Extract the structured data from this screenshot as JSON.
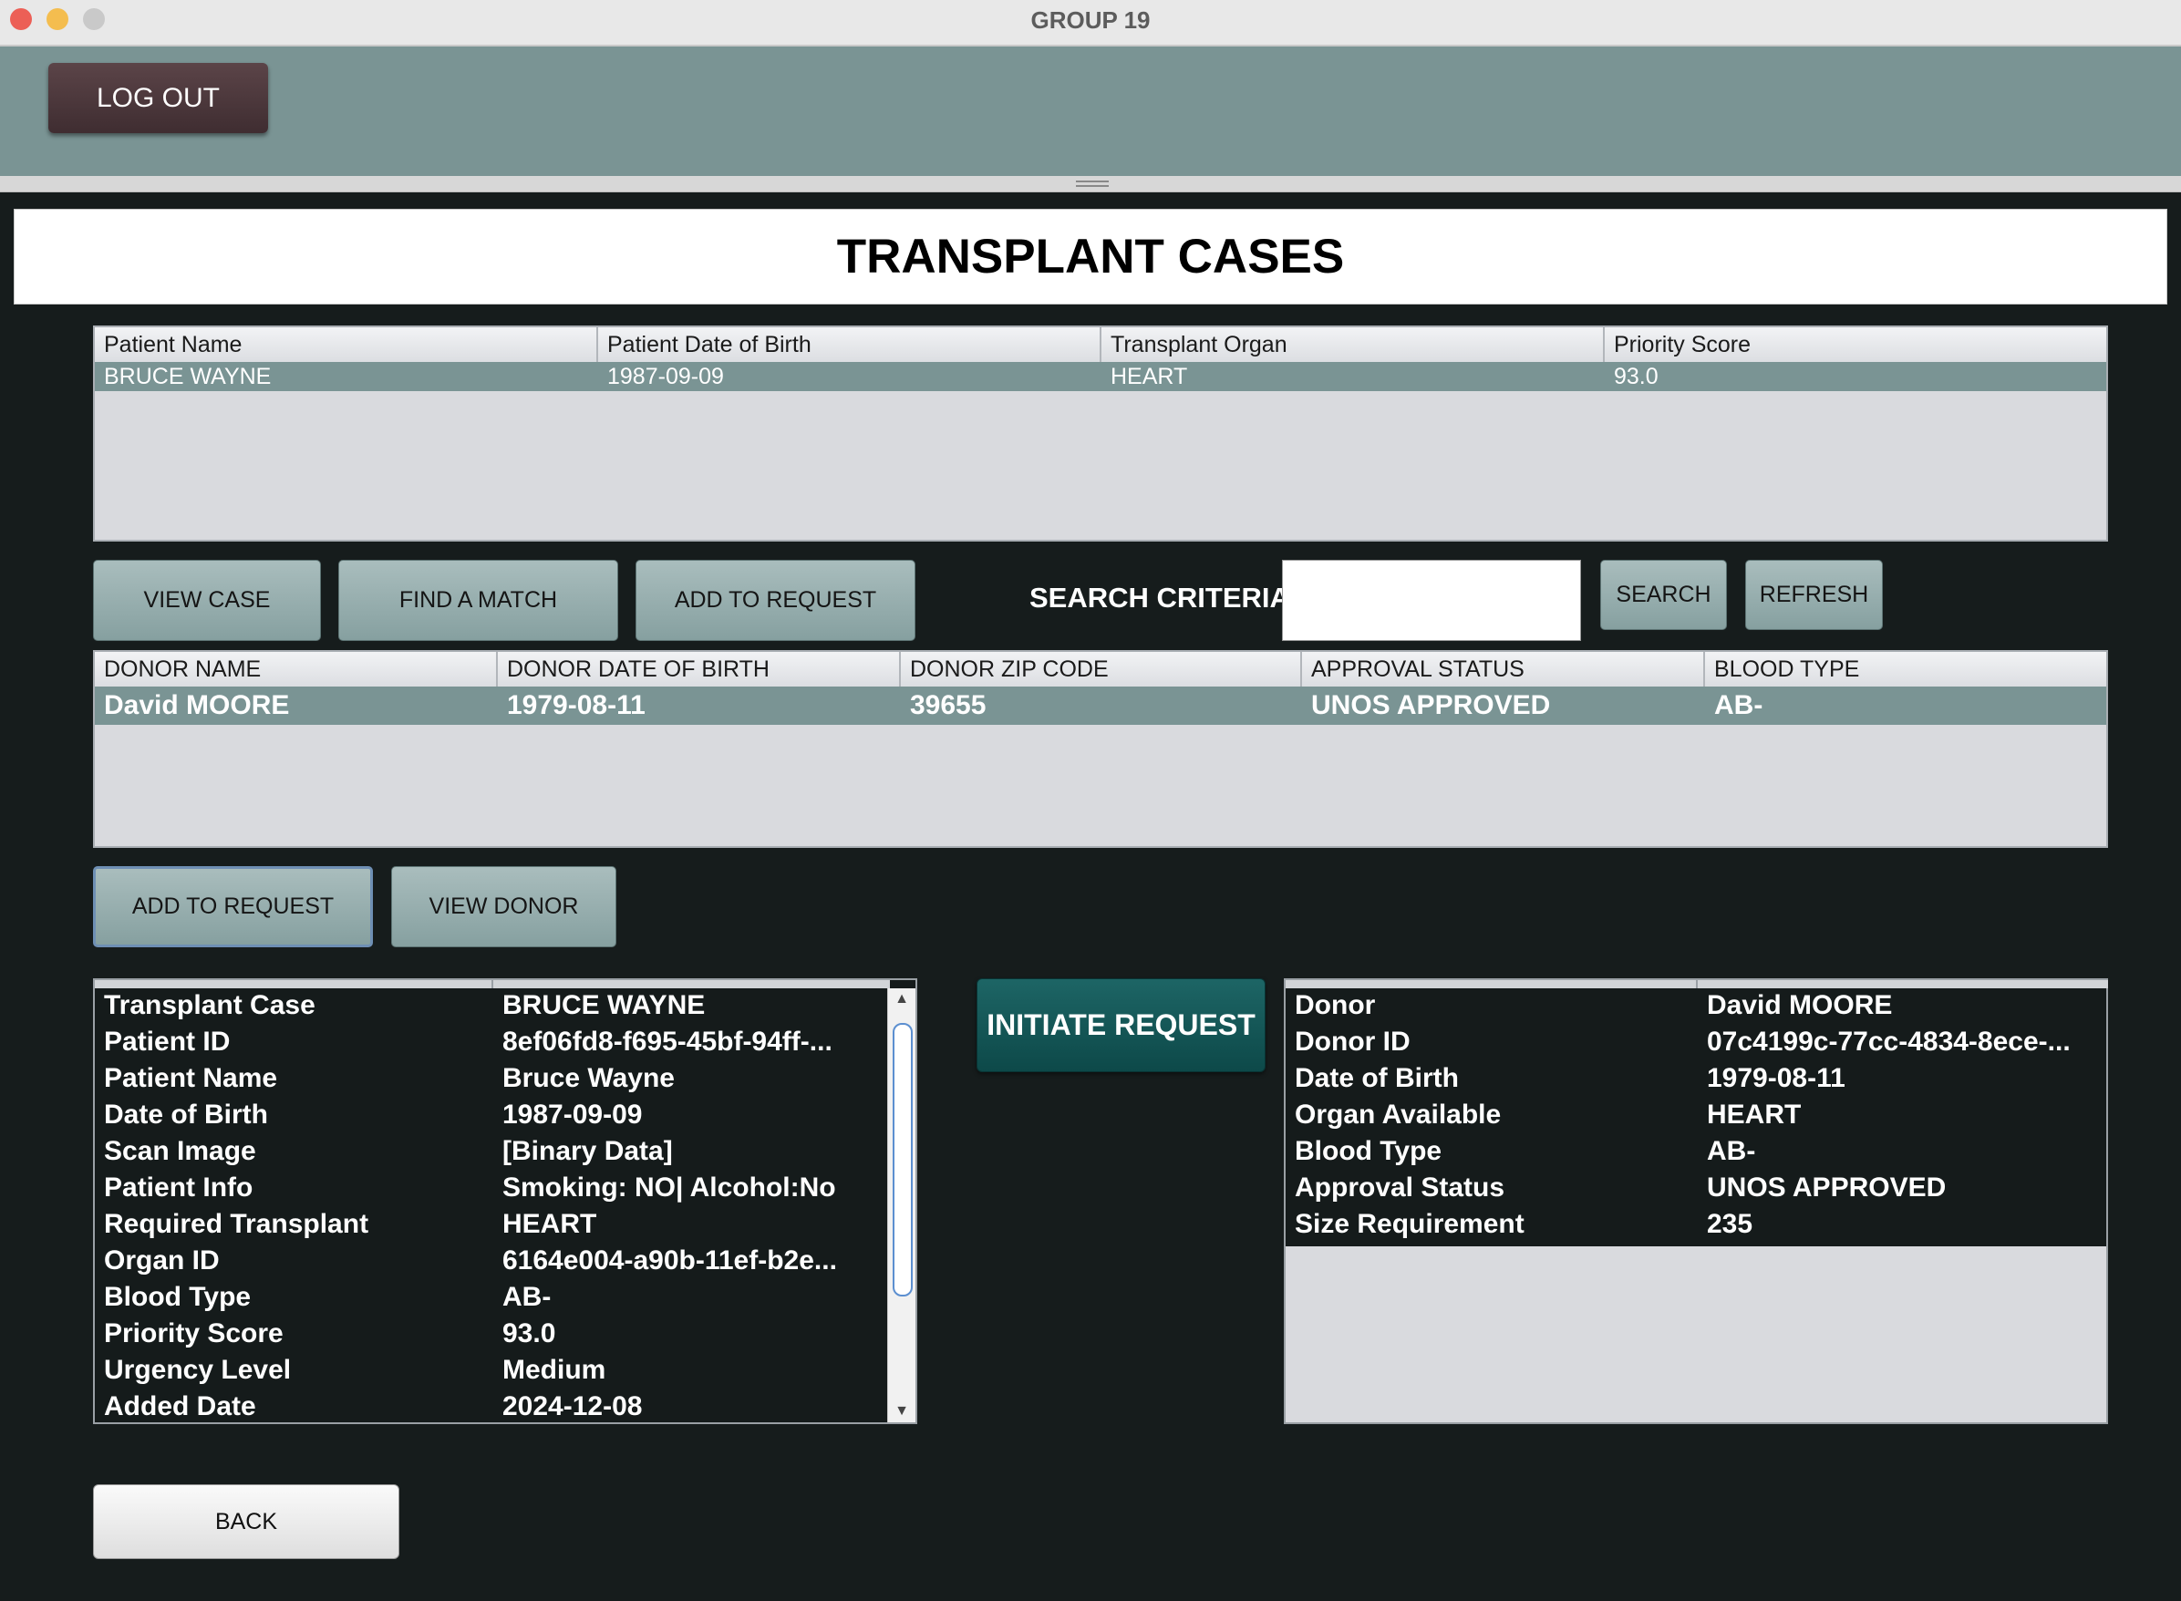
{
  "window": {
    "title": "GROUP 19"
  },
  "top_panel": {
    "logout_label": "LOG OUT"
  },
  "page": {
    "heading": "TRANSPLANT CASES"
  },
  "cases_table": {
    "columns": [
      "Patient Name",
      "Patient Date of Birth",
      "Transplant Organ",
      "Priority Score"
    ],
    "rows": [
      [
        "BRUCE WAYNE",
        "1987-09-09",
        "HEART",
        "93.0"
      ]
    ]
  },
  "case_actions": {
    "view_case": "VIEW CASE",
    "find_match": "FIND A MATCH",
    "add_to_request": "ADD TO REQUEST"
  },
  "search": {
    "label": "SEARCH CRITERIA",
    "value": "",
    "search_button": "SEARCH",
    "refresh_button": "REFRESH"
  },
  "donor_table": {
    "columns": [
      "DONOR NAME",
      "DONOR DATE OF BIRTH",
      "DONOR ZIP CODE",
      "APPROVAL STATUS",
      "BLOOD TYPE"
    ],
    "rows": [
      [
        "David MOORE",
        "1979-08-11",
        "39655",
        "UNOS APPROVED",
        "AB-"
      ]
    ]
  },
  "donor_actions": {
    "add_to_request": "ADD TO REQUEST",
    "view_donor": "VIEW DONOR"
  },
  "case_details": [
    [
      "Transplant Case",
      "BRUCE WAYNE"
    ],
    [
      "Patient ID",
      "8ef06fd8-f695-45bf-94ff-..."
    ],
    [
      "Patient Name",
      "Bruce Wayne"
    ],
    [
      "Date of Birth",
      "1987-09-09"
    ],
    [
      "Scan Image",
      "[Binary Data]"
    ],
    [
      "Patient Info",
      "Smoking: NO| Alcohol:No"
    ],
    [
      "Required Transplant",
      "HEART"
    ],
    [
      "Organ ID",
      "6164e004-a90b-11ef-b2e..."
    ],
    [
      "Blood Type",
      "AB-"
    ],
    [
      "Priority Score",
      "93.0"
    ],
    [
      "Urgency Level",
      "Medium"
    ],
    [
      "Added Date",
      "2024-12-08"
    ]
  ],
  "initiate_request_label": "INITIATE REQUEST",
  "donor_details": [
    [
      "Donor",
      "David MOORE"
    ],
    [
      "Donor ID",
      "07c4199c-77cc-4834-8ece-..."
    ],
    [
      "Date of Birth",
      "1979-08-11"
    ],
    [
      "Organ Available",
      "HEART"
    ],
    [
      "Blood Type",
      "AB-"
    ],
    [
      "Approval Status",
      "UNOS APPROVED"
    ],
    [
      "Size Requirement",
      "235"
    ]
  ],
  "back_label": "BACK",
  "colors": {
    "background": "#161c1c",
    "panel": "#7a9494",
    "selected_row": "#7a9494",
    "logout_button": "#4a3539",
    "initiate_button": "#145656"
  },
  "icons": {
    "scroll_up": "▲",
    "scroll_down": "▼"
  }
}
